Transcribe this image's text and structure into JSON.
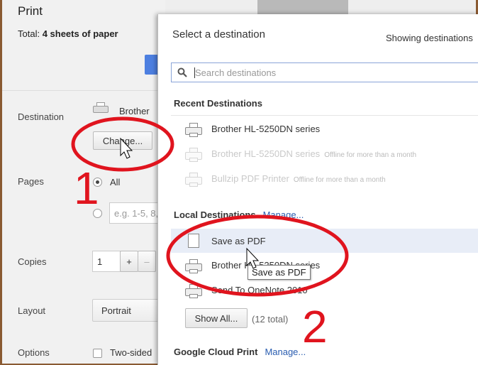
{
  "print": {
    "title": "Print",
    "total_prefix": "Total: ",
    "total_value": "4 sheets of paper",
    "destination_label": "Destination",
    "destination_name": "Brother",
    "change_button": "Change...",
    "pages_label": "Pages",
    "pages_all": "All",
    "pages_custom_placeholder": "e.g. 1-5, 8,",
    "copies_label": "Copies",
    "copies_value": "1",
    "copies_plus": "+",
    "copies_minus": "–",
    "layout_label": "Layout",
    "layout_value": "Portrait",
    "options_label": "Options",
    "two_sided": "Two-sided"
  },
  "dialog": {
    "title": "Select a destination",
    "showing": "Showing destinations",
    "search_placeholder": "Search destinations",
    "recent_heading": "Recent Destinations",
    "recent": [
      {
        "name": "Brother HL-5250DN series",
        "note": "",
        "offline": false
      },
      {
        "name": "Brother HL-5250DN series",
        "note": "Offline for more than a month",
        "offline": true
      },
      {
        "name": "Bullzip PDF Printer",
        "note": "Offline for more than a month",
        "offline": true
      }
    ],
    "local_heading": "Local Destinations",
    "local_manage": "Manage...",
    "local": [
      {
        "name": "Save as PDF",
        "icon": "pdf-icon"
      },
      {
        "name": "Brother HL-5250DN series",
        "icon": "printer-icon"
      },
      {
        "name": "Send To OneNote 2010",
        "icon": "printer-icon"
      }
    ],
    "show_all": "Show All...",
    "total_count": "(12 total)",
    "cloud_heading": "Google Cloud Print",
    "cloud_manage": "Manage...",
    "tooltip": "Save as PDF"
  },
  "annotations": {
    "step1": "1",
    "step2": "2",
    "color": "#e0141e"
  }
}
